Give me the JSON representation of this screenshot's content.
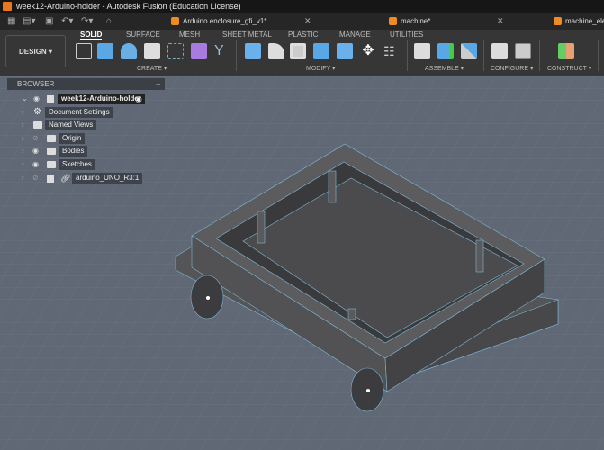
{
  "window": {
    "title": "week12-Arduino-holder - Autodesk Fusion (Education License)"
  },
  "tabs": [
    {
      "label": "Arduino enclosure_gfi_v1*"
    },
    {
      "label": "machine*"
    },
    {
      "label": "machine_elec"
    }
  ],
  "toolbar": {
    "workspace": "DESIGN ▾",
    "ribbon_tabs": [
      "SOLID",
      "SURFACE",
      "MESH",
      "SHEET METAL",
      "PLASTIC",
      "MANAGE",
      "UTILITIES"
    ],
    "active_tab": "SOLID",
    "groups": [
      "CREATE ▾",
      "MODIFY ▾",
      "ASSEMBLE ▾",
      "CONFIGURE ▾",
      "CONSTRUCT ▾"
    ]
  },
  "browser": {
    "title": "BROWSER",
    "root": "week12-Arduino-holder",
    "items": [
      {
        "label": "Document Settings",
        "icon": "gear-icon"
      },
      {
        "label": "Named Views",
        "icon": "folder-icon"
      },
      {
        "label": "Origin",
        "icon": "folder-icon",
        "visible": false
      },
      {
        "label": "Bodies",
        "icon": "folder-icon",
        "visible": true
      },
      {
        "label": "Sketches",
        "icon": "folder-icon",
        "visible": true
      },
      {
        "label": "arduino_UNO_R3:1",
        "icon": "component-link-icon",
        "visible": false
      }
    ]
  },
  "colors": {
    "accent": "#f08a24",
    "model": "#4a4a4c",
    "viewport": "#5f6874"
  }
}
